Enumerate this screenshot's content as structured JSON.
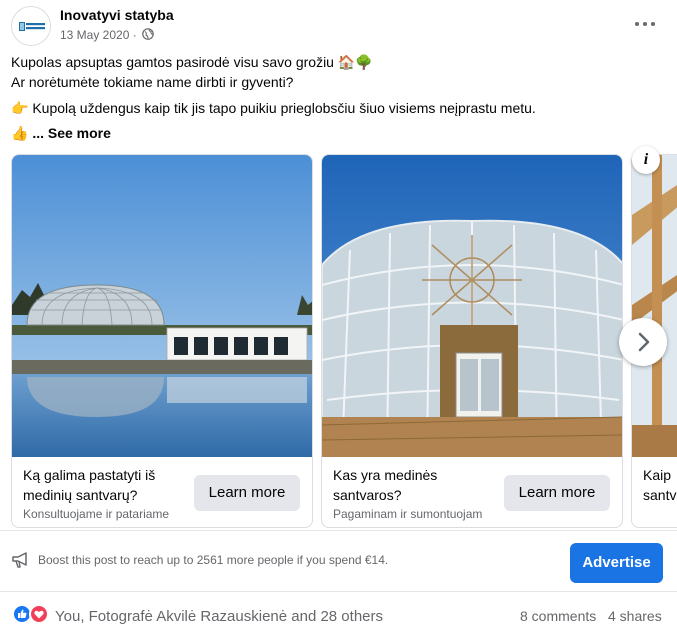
{
  "post": {
    "page_name": "Inovatyvi statyba",
    "date": "13 May 2020",
    "date_sep": " ·",
    "avatar_text": "INOVATYVI STATYBA",
    "text_line1": "Kupolas apsuptas gamtos pasirodė visu savo grožiu 🏠🌳",
    "text_line2": "Ar norėtumėte tokiame name dirbti ir gyventi?",
    "text_line3": "👉 Kupolą uždengus kaip tik jis tapo puikiu prieglobsčiu šiuo visiems neįprastu metu.",
    "text_line4_emoji": "👍",
    "see_more": "... See more"
  },
  "carousel": {
    "cards": [
      {
        "headline": "Ką galima pastatyti iš medinių santvarų?",
        "subtitle": "Konsultuojame ir patariame",
        "button": "Learn more"
      },
      {
        "headline": "Kas yra medinės santvaros?",
        "subtitle": "Pagaminam ir sumontuojam",
        "button": "Learn more"
      },
      {
        "headline": "Kaip",
        "headline2": "santv"
      }
    ],
    "info_glyph": "i",
    "next_glyph": "›"
  },
  "boost": {
    "text": "Boost this post to reach up to 2561 more people if you spend €14.",
    "button": "Advertise"
  },
  "footer": {
    "reactions_text": "You, Fotografė Akvilė Razauskienė and 28 others",
    "comments": "8 comments",
    "shares": "4 shares"
  },
  "colors": {
    "brand_blue": "#1b74e4",
    "like_blue": "#1877f2",
    "love_red": "#f33e58",
    "secondary_text": "#65676b"
  },
  "icons": [
    "globe-icon",
    "more-options-icon",
    "megaphone-icon",
    "like-icon",
    "love-icon",
    "chevron-right-icon",
    "info-icon"
  ]
}
